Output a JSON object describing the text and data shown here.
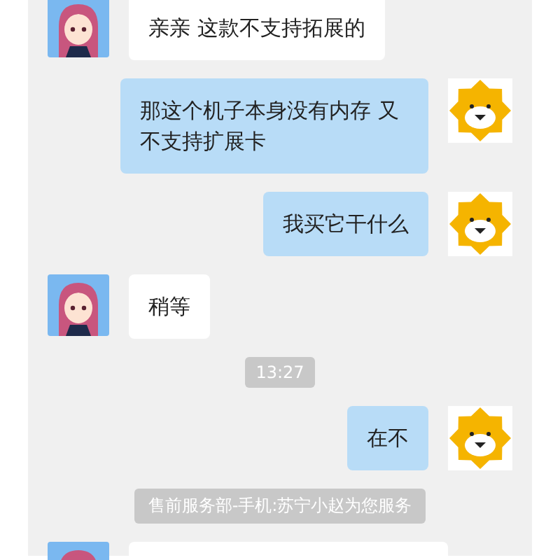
{
  "messages": [
    {
      "kind": "agent",
      "text": "亲亲 这款不支持拓展的"
    },
    {
      "kind": "user",
      "text": "那这个机子本身没有内存  又不支持扩展卡"
    },
    {
      "kind": "user",
      "text": "我买它干什么"
    },
    {
      "kind": "agent",
      "text": "稍等"
    },
    {
      "kind": "time",
      "text": "13:27"
    },
    {
      "kind": "user",
      "text": "在不"
    },
    {
      "kind": "system",
      "text": "售前服务部-手机:苏宁小赵为您服务"
    },
    {
      "kind": "agent"
    }
  ]
}
